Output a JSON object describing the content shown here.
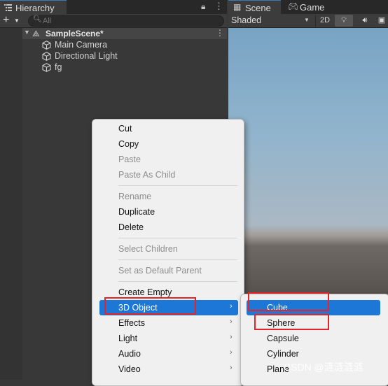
{
  "hierarchy": {
    "tab_label": "Hierarchy",
    "add_label": "+",
    "search_placeholder": "All",
    "scene_name": "SampleScene*",
    "objects": [
      "Main Camera",
      "Directional Light",
      "fg"
    ]
  },
  "scene_panel": {
    "tabs": [
      "Scene",
      "Game"
    ],
    "shading_mode": "Shaded",
    "toolbar": {
      "mode_2d": "2D"
    }
  },
  "context_menu": {
    "items": [
      {
        "label": "Cut",
        "enabled": true
      },
      {
        "label": "Copy",
        "enabled": true
      },
      {
        "label": "Paste",
        "enabled": false
      },
      {
        "label": "Paste As Child",
        "enabled": false
      },
      {
        "label": "Rename",
        "enabled": false
      },
      {
        "label": "Duplicate",
        "enabled": true
      },
      {
        "label": "Delete",
        "enabled": true
      },
      {
        "label": "Select Children",
        "enabled": false
      },
      {
        "label": "Set as Default Parent",
        "enabled": false
      },
      {
        "label": "Create Empty",
        "enabled": true
      },
      {
        "label": "3D Object",
        "enabled": true,
        "submenu": true,
        "highlighted": true
      },
      {
        "label": "Effects",
        "enabled": true,
        "submenu": true
      },
      {
        "label": "Light",
        "enabled": true,
        "submenu": true
      },
      {
        "label": "Audio",
        "enabled": true,
        "submenu": true
      },
      {
        "label": "Video",
        "enabled": true,
        "submenu": true
      }
    ]
  },
  "submenu": {
    "items": [
      {
        "label": "Cube",
        "highlighted": true
      },
      {
        "label": "Sphere"
      },
      {
        "label": "Capsule"
      },
      {
        "label": "Cylinder"
      },
      {
        "label": "Plane"
      }
    ]
  },
  "watermark": "CSDN @涟涟涟涟",
  "colors": {
    "accent": "#1c77d6",
    "annotation": "#e3252a",
    "panel_bg": "#383838",
    "menu_bg": "#f0f0f0"
  },
  "icons": {
    "hierarchy_tab": "list-icon",
    "lock": "lock-icon",
    "menu": "kebab-icon",
    "scene_tab": "grid-icon",
    "game_tab": "gamepad-icon",
    "gameobject": "cube-icon",
    "search": "search-icon"
  }
}
